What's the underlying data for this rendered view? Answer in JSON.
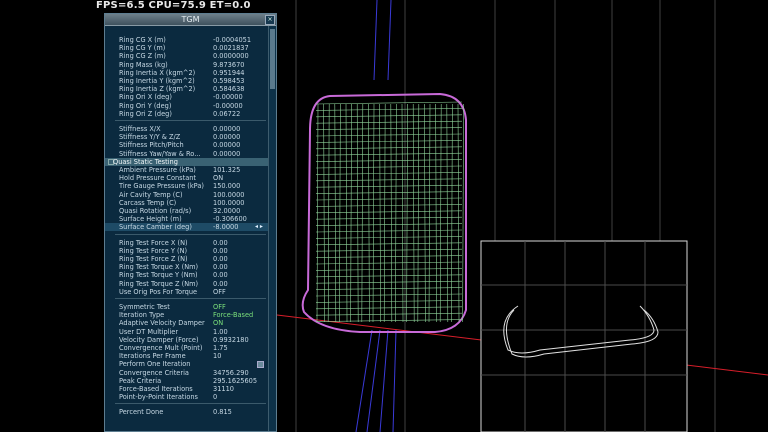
{
  "hud": {
    "fps_text": "FPS=6.5 CPU=75.9 ET=0.0"
  },
  "panel": {
    "title": "TGM",
    "close_glyph": "×",
    "top_rows": [
      {
        "label": "Ring CG X (m)",
        "value": "-0.0004051"
      },
      {
        "label": "Ring CG Y (m)",
        "value": "0.0021837"
      },
      {
        "label": "Ring CG Z (m)",
        "value": "0.0000000"
      },
      {
        "label": "Ring Mass (kg)",
        "value": "9.873670"
      },
      {
        "label": "Ring Inertia X (kgm^2)",
        "value": "0.951944"
      },
      {
        "label": "Ring Inertia Y (kgm^2)",
        "value": "0.598453"
      },
      {
        "label": "Ring Inertia Z (kgm^2)",
        "value": "0.584638"
      },
      {
        "label": "Ring Ori X (deg)",
        "value": "-0.00000"
      },
      {
        "label": "Ring Ori Y (deg)",
        "value": "-0.00000"
      },
      {
        "label": "Ring Ori Z (deg)",
        "value": "0.06722"
      }
    ],
    "stiffness_rows": [
      {
        "label": "Stiffness X/X",
        "value": "0.00000"
      },
      {
        "label": "Stiffness Y/Y & Z/Z",
        "value": "0.00000"
      },
      {
        "label": "Stiffness Pitch/Pitch",
        "value": "0.00000"
      },
      {
        "label": "Stiffness Yaw/Yaw & Ro...",
        "value": "0.00000"
      }
    ],
    "section_title": "Quasi Static Testing",
    "qs_rows": [
      {
        "label": "Ambient Pressure (kPa)",
        "value": "101.325"
      },
      {
        "label": "Hold Pressure Constant",
        "value": "ON"
      },
      {
        "label": "Tire Gauge Pressure (kPa)",
        "value": "150.000"
      },
      {
        "label": "Air Cavity Temp (C)",
        "value": "100.0000"
      },
      {
        "label": "Carcass Temp (C)",
        "value": "100.0000"
      },
      {
        "label": "Quasi Rotation (rad/s)",
        "value": "32.0000"
      },
      {
        "label": "Surface Height (m)",
        "value": "-0.306600"
      },
      {
        "label": "Surface Camber (deg)",
        "value": "-8.0000"
      }
    ],
    "camber_arrows": "◂ ▸",
    "force_rows": [
      {
        "label": "Ring Test Force X (N)",
        "value": "0.00"
      },
      {
        "label": "Ring Test Force Y (N)",
        "value": "0.00"
      },
      {
        "label": "Ring Test Force Z (N)",
        "value": "0.00"
      },
      {
        "label": "Ring Test Torque X (Nm)",
        "value": "0.00"
      },
      {
        "label": "Ring Test Torque Y (Nm)",
        "value": "0.00"
      },
      {
        "label": "Ring Test Torque Z (Nm)",
        "value": "0.00"
      },
      {
        "label": "Use Orig Pos For Torque",
        "value": "OFF"
      }
    ],
    "iter_rows": [
      {
        "label": "Symmetric Test",
        "value": "OFF",
        "green": true
      },
      {
        "label": "Iteration Type",
        "value": "Force-Based",
        "green": true
      },
      {
        "label": "Adaptive Velocity Damper",
        "value": "ON",
        "green": true
      },
      {
        "label": "User DT Multiplier",
        "value": "1.00"
      },
      {
        "label": "Velocity Damper (Force)",
        "value": "0.9932180"
      },
      {
        "label": "Convergence Mult (Point)",
        "value": "1.75"
      },
      {
        "label": "Iterations Per Frame",
        "value": "10"
      },
      {
        "label": "Perform One Iteration",
        "value": ""
      },
      {
        "label": "Convergence Criteria",
        "value": "34756.290"
      },
      {
        "label": "Peak Criteria",
        "value": "295.1625605"
      },
      {
        "label": "Force-Based Iterations",
        "value": "31110"
      },
      {
        "label": "Point-by-Point Iterations",
        "value": "0"
      }
    ],
    "bottom_rows": [
      {
        "label": "Percent Done",
        "value": "0.815"
      }
    ]
  },
  "colors": {
    "panel_bg": "#0b2a3f",
    "mesh_green": "#8fd39a",
    "mesh_magenta": "#c86ad8",
    "ground_red": "#d81e2a",
    "axis_blue": "#3a3ad8"
  }
}
